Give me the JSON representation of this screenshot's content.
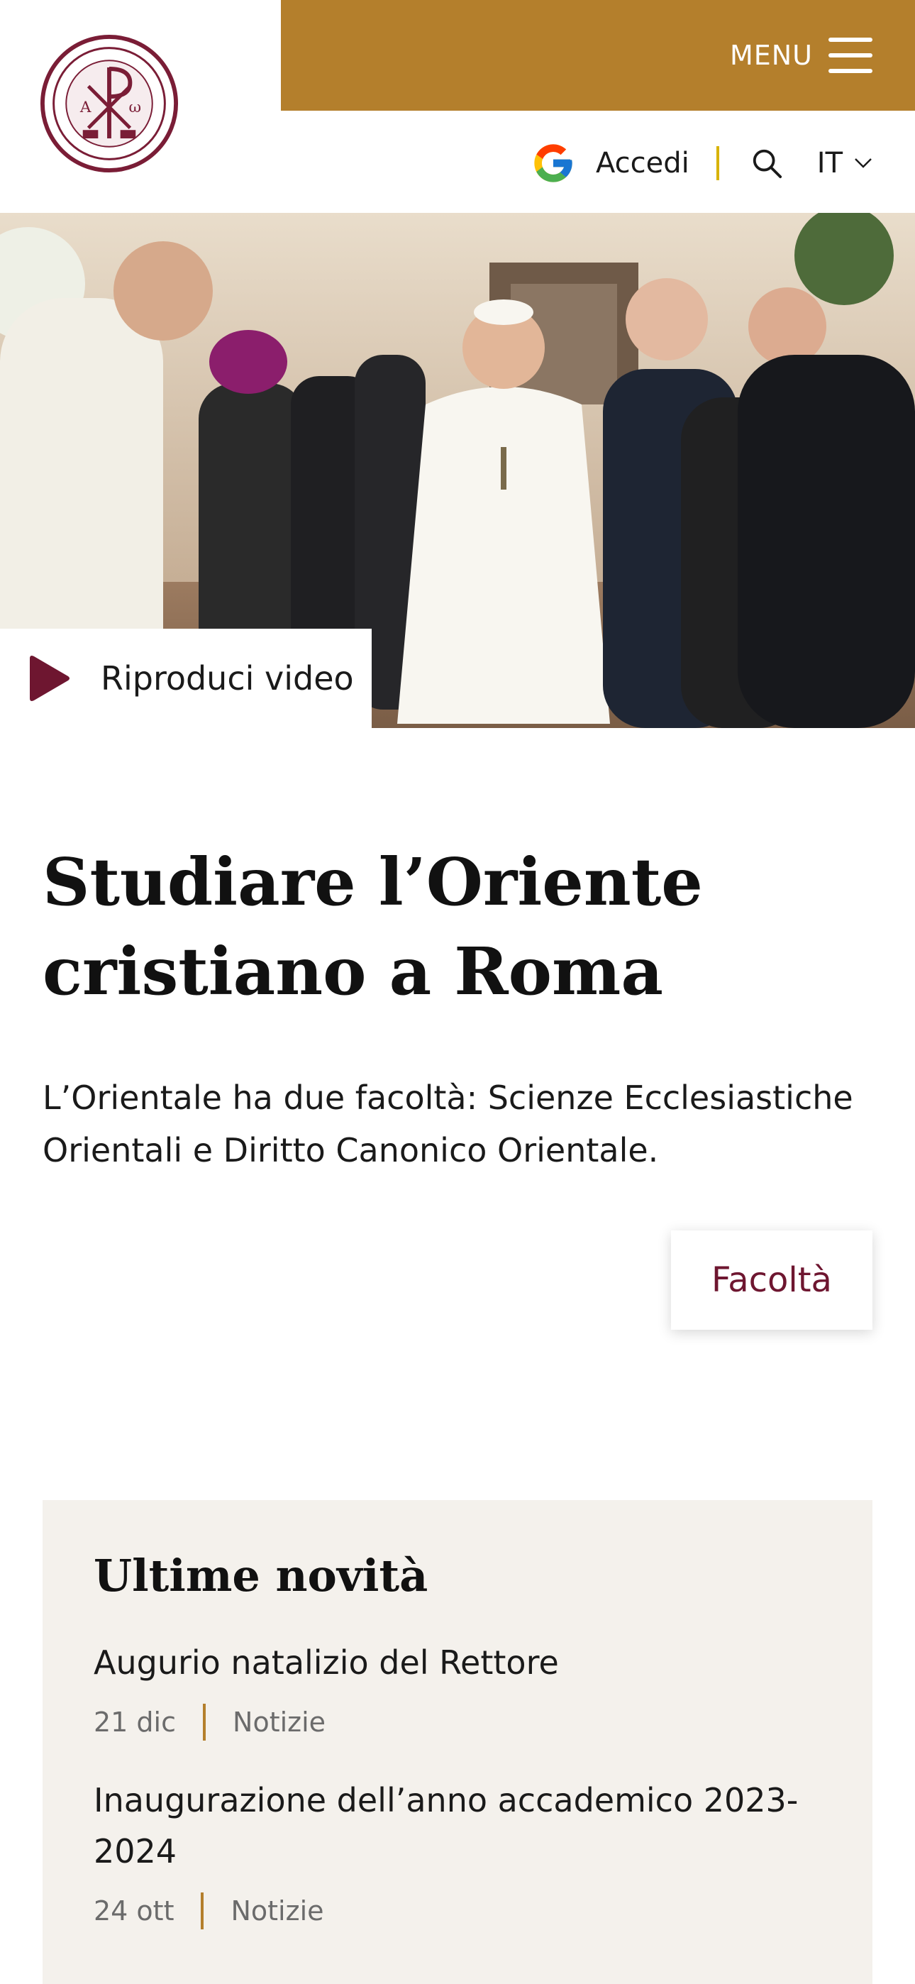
{
  "header": {
    "menu_label": "MENU",
    "login_label": "Accedi",
    "language": "IT",
    "accent_color": "#b47f2c"
  },
  "hero": {
    "play_label": "Riproduci video"
  },
  "intro": {
    "title": "Studiare l’Oriente cristiano a Roma",
    "subtitle": "L’Orientale ha due facoltà: Scienze Ecclesiastiche Orientali e Diritto Canonico Orientale.",
    "button_label": "Facoltà"
  },
  "news": {
    "title": "Ultime novità",
    "items": [
      {
        "title": "Augurio natalizio del Rettore",
        "date": "21 dic",
        "category": "Notizie"
      },
      {
        "title": "Inaugurazione dell’anno accademico 2023-2024",
        "date": "24 ott",
        "category": "Notizie"
      }
    ]
  },
  "icons": [
    "logo-seal",
    "hamburger-icon",
    "google-icon",
    "search-icon",
    "chevron-down-icon",
    "play-icon"
  ]
}
